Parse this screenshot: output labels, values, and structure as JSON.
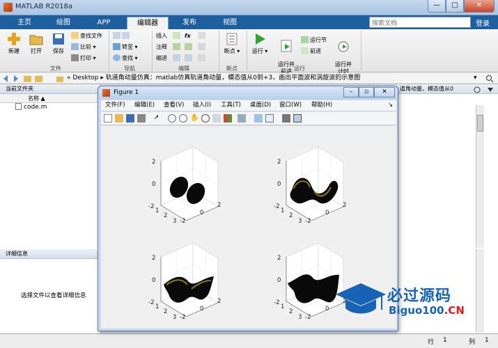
{
  "window": {
    "title": "MATLAB R2018a",
    "min": "—",
    "max": "□",
    "close": "✕"
  },
  "tabs": [
    "主页",
    "绘图",
    "APP",
    "编辑器",
    "发布",
    "视图"
  ],
  "search": {
    "placeholder": "搜索文档"
  },
  "login": "登录",
  "ribbon": {
    "new": "新建",
    "open": "打开",
    "save": "保存",
    "find_files": "查找文件",
    "compare": "比较",
    "print": "打印",
    "goto": "转至",
    "find": "查找",
    "insert": "插入",
    "comment": "注释",
    "indent": "缩进",
    "fx": "fx",
    "breakpoints": "断点",
    "run": "运行",
    "run_advance": "运行并\n前进",
    "run_section": "运行节",
    "advance": "前进",
    "run_time": "运行并\n计时",
    "groups": {
      "file": "文件",
      "navigate": "导航",
      "edit": "编辑",
      "breakpoints": "断点",
      "run": "运行"
    }
  },
  "address": {
    "path": "« Desktop ▸ 轨道角动量仿真：matlab仿真轨道角动量，模态值从0到+3，画出平面波和涡旋波的示意图"
  },
  "left_panel": {
    "title": "当前文件夹",
    "column": "名称 ▲",
    "files": [
      "code.m"
    ],
    "details_title": "详细信息",
    "details_hint": "选择文件以查看详细信息"
  },
  "editor": {
    "title_fragment": "道角动量，模态值从0"
  },
  "status": {
    "row_label": "行",
    "row": "1",
    "col_label": "列",
    "col": "1"
  },
  "figure": {
    "title": "Figure 1",
    "menu": [
      "文件(F)",
      "编辑(E)",
      "查看(V)",
      "插入(I)",
      "工具(T)",
      "桌面(D)",
      "窗口(W)",
      "帮助(H)"
    ],
    "ticks": {
      "z": [
        "2",
        "0",
        "-2"
      ],
      "x": [
        "1",
        "2",
        "3"
      ],
      "y": [
        "-2",
        "0",
        "2"
      ]
    }
  },
  "watermark": {
    "cn": "必过源码",
    "en_main": "Biguo100",
    "en_suffix": ".CN"
  },
  "colors": {
    "accent": "#1d5f9e",
    "surface": "#0a0a0a",
    "surface_mesh": "#8c7a18"
  }
}
